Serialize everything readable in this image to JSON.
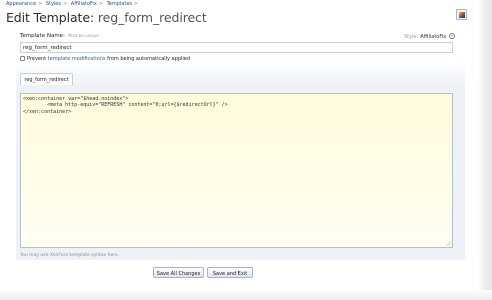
{
  "breadcrumb": {
    "items": [
      "Appearance",
      "Styles",
      "AffiliatoFix",
      "Templates"
    ],
    "separator": ">"
  },
  "title": {
    "prefix": "Edit Template:",
    "name": "reg_form_redirect"
  },
  "icons": {
    "title_icon": "xenforo-logo-icon",
    "dropdown": "chevron-down-icon"
  },
  "form": {
    "name_label": "Template Name:",
    "name_hint": "Must be unique",
    "name_value": "reg_form_redirect",
    "style_label": "Style:",
    "style_value": "AffiliatoFix",
    "prevent_prefix": "Prevent",
    "prevent_link": "template modifications",
    "prevent_suffix": "from being automatically applied",
    "prevent_checked": false
  },
  "tabs": [
    {
      "label": "reg_form_redirect",
      "active": true
    }
  ],
  "editor": {
    "code": "<xen:container var=\"$head.noindex\">\n        <meta http-equiv=\"REFRESH\" content=\"0;url={$redirectUrl}\" />\n</xen:container>"
  },
  "syntax_note": "You may use XenForo template syntax here.",
  "buttons": {
    "save_all": "Save All Changes",
    "save_exit": "Save and Exit"
  },
  "colors": {
    "link": "#2b5fa0",
    "editor_background": "#fffde8"
  }
}
